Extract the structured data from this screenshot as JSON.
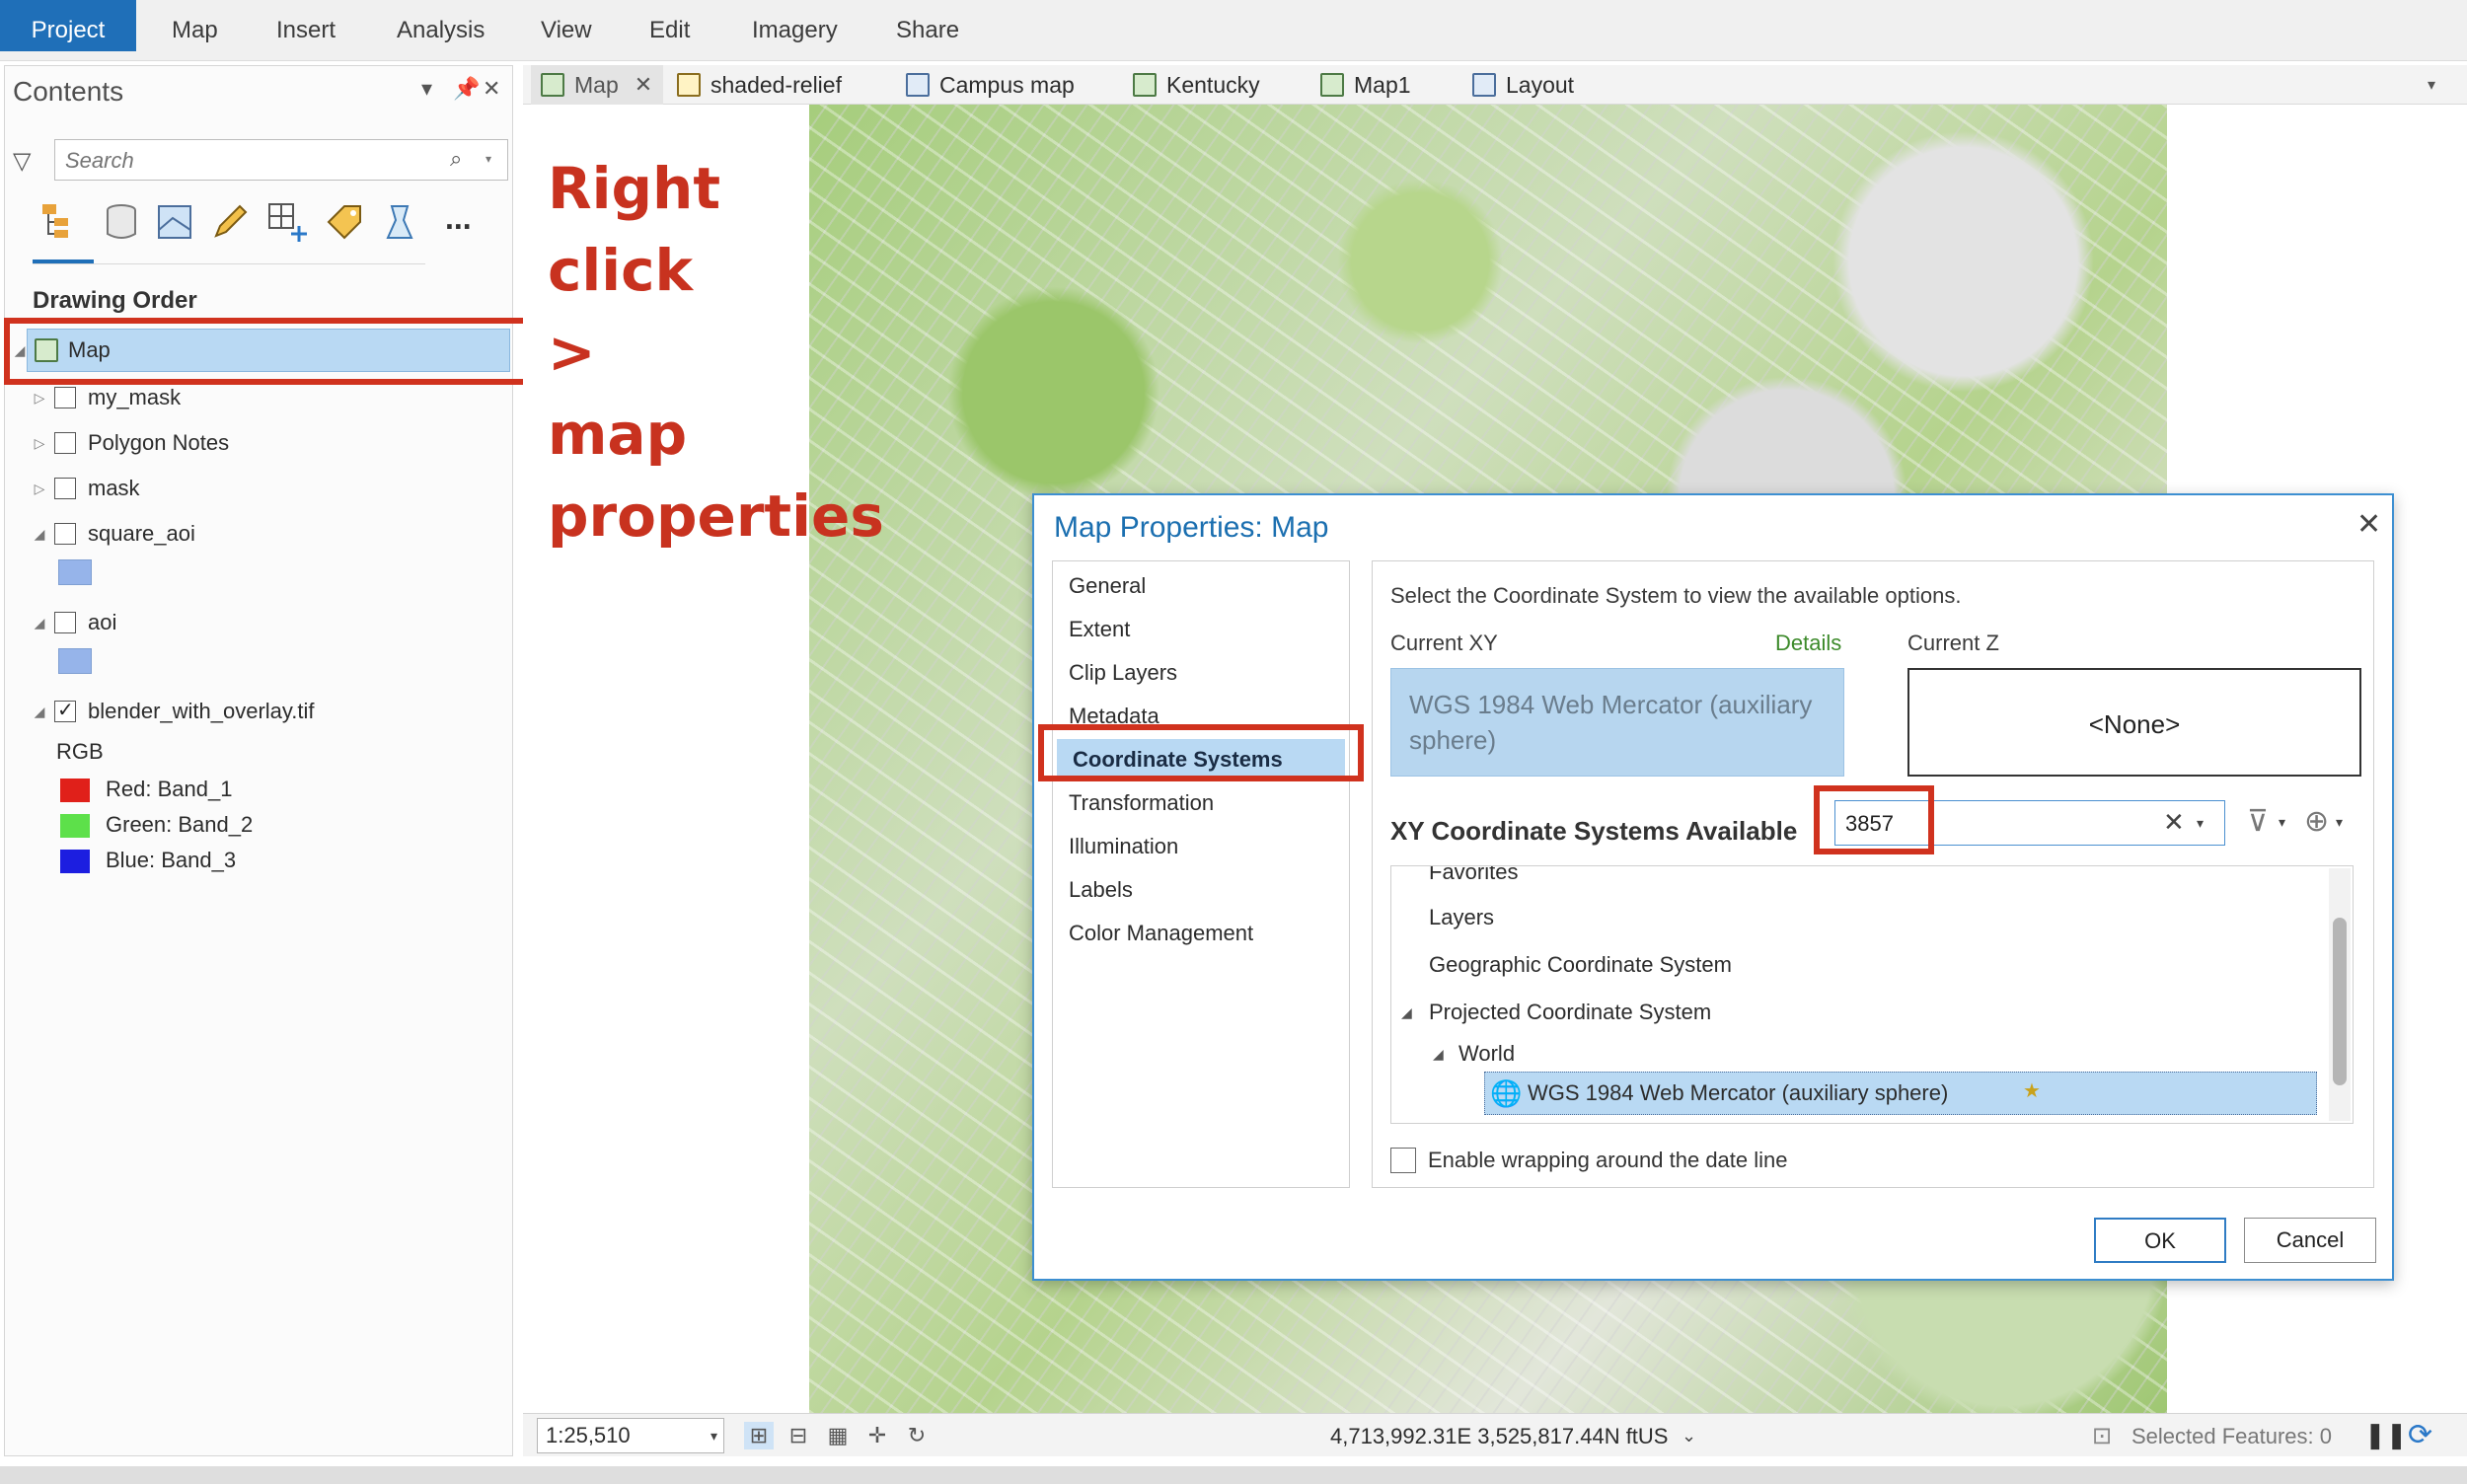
{
  "ribbon": {
    "tabs": [
      "Project",
      "Map",
      "Insert",
      "Analysis",
      "View",
      "Edit",
      "Imagery",
      "Share"
    ]
  },
  "contents": {
    "title": "Contents",
    "search_placeholder": "Search",
    "section_title": "Drawing Order",
    "layers": {
      "map": "Map",
      "my_mask": "my_mask",
      "polygon_notes": "Polygon Notes",
      "mask": "mask",
      "square_aoi": "square_aoi",
      "aoi": "aoi",
      "blender": "blender_with_overlay.tif",
      "rgb": "RGB",
      "red": "Red:   Band_1",
      "green": "Green: Band_2",
      "blue": "Blue:  Band_3"
    },
    "more_icon": "..."
  },
  "map_tabs": [
    "Map",
    "shaded-relief",
    "Campus map",
    "Kentucky",
    "Map1",
    "Layout"
  ],
  "annotation": {
    "line1": "Right",
    "line2": "click",
    "line3": ">",
    "line4": "map",
    "line5": "properties",
    "color": "#c8321f"
  },
  "dialog": {
    "title": "Map Properties: Map",
    "nav": [
      "General",
      "Extent",
      "Clip Layers",
      "Metadata",
      "Coordinate Systems",
      "Transformation",
      "Illumination",
      "Labels",
      "Color Management"
    ],
    "instruction": "Select the Coordinate System to view the available options.",
    "current_xy_label": "Current XY",
    "details_link": "Details",
    "current_z_label": "Current Z",
    "current_xy_value": "WGS 1984 Web Mercator (auxiliary sphere)",
    "current_z_value": "<None>",
    "xy_available_label": "XY Coordinate Systems Available",
    "search_value": "3857",
    "tree": {
      "favorites": "Favorites",
      "layers": "Layers",
      "geographic": "Geographic Coordinate System",
      "projected": "Projected Coordinate System",
      "world": "World",
      "selected": "WGS 1984 Web Mercator (auxiliary sphere)"
    },
    "wrap_label": "Enable wrapping around the date line",
    "ok": "OK",
    "cancel": "Cancel"
  },
  "statusbar": {
    "scale": "1:25,510",
    "coordinates": "4,713,992.31E 3,525,817.44N ftUS",
    "selected_features": "Selected Features: 0"
  },
  "colors": {
    "accent": "#1f6fb8",
    "highlight": "#d0321e",
    "selection": "#b9d9f3"
  }
}
